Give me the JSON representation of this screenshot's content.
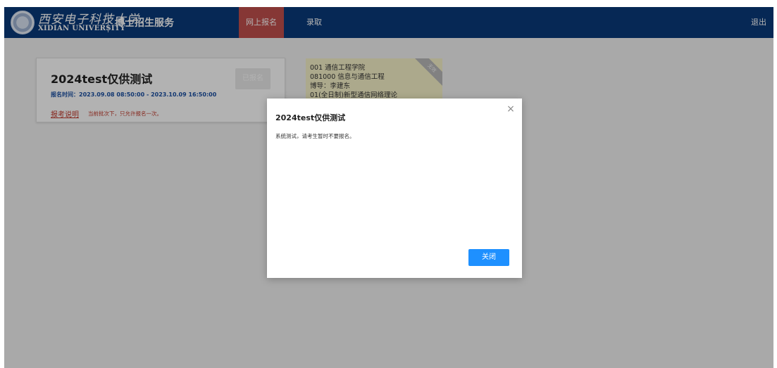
{
  "header": {
    "logo_cn": "西安电子科技大学",
    "logo_en": "XIDIAN UNIVERSITY",
    "portal_title": "博士招生服务",
    "nav": [
      {
        "label": "网上报名",
        "active": true
      },
      {
        "label": "录取",
        "active": false
      }
    ],
    "logout_label": "退出"
  },
  "batch": {
    "title": "2024test仅供测试",
    "time": "报名时间：2023.09.08 08:50:00 - 2023.10.09 16:50:00",
    "notice_link": "报考说明",
    "notice_text": "当前批次下，只允许报名一次。",
    "status_button": "已报名"
  },
  "application": {
    "lines": [
      "001 通信工程学院",
      "081000 信息与通信工程",
      "博导：李建东",
      "01(全日制)新型通信网络理论"
    ],
    "ribbon": "无效"
  },
  "modal": {
    "title": "2024test仅供测试",
    "close_icon": "×",
    "body": "系统测试，请考生暂时不要报名。",
    "close_button": "关闭"
  },
  "colors": {
    "header_bg": "#0a3a7a",
    "nav_active": "#c0504d",
    "primary_button": "#1e90ff",
    "application_card": "#f7f2c9"
  }
}
